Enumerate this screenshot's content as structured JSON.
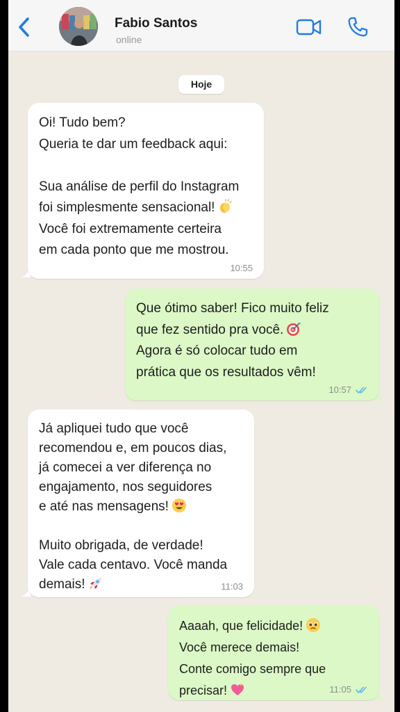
{
  "header": {
    "contact_name": "Fabio Santos",
    "status": "online"
  },
  "chat": {
    "date_label": "Hoje",
    "messages": [
      {
        "direction": "incoming",
        "lines": [
          "Oi! Tudo bem?",
          "Queria te dar um feedback aqui:",
          "",
          "Sua análise de perfil do Instagram",
          "foi simplesmente sensacional!",
          "Você foi extremamente certeira",
          "em cada ponto que me mostrou."
        ],
        "emoji": "clapping-hands",
        "time": "10:55"
      },
      {
        "direction": "outgoing",
        "lines": [
          "Que ótimo saber!  Fico muito feliz",
          "que fez sentido pra você.",
          "Agora é só colocar tudo em",
          "prática que os resultados vêm!"
        ],
        "emoji": "direct-hit-target",
        "time": "10:57",
        "read": true
      },
      {
        "direction": "incoming",
        "lines": [
          "Já apliquei tudo que você",
          "recomendou e, em poucos dias,",
          "já comecei a ver diferença no",
          "engajamento, nos seguidores",
          "e até nas mensagens!",
          "",
          "Muito obrigada, de verdade!",
          "Vale cada centavo. Você manda",
          "demais!"
        ],
        "emoji": [
          "smiling-face-with-heart-eyes",
          "rocket"
        ],
        "time": "11:03"
      },
      {
        "direction": "outgoing",
        "lines": [
          "Aaaah, que felicidade!",
          "Você merece demais!",
          "Conte comigo sempre que",
          "precisar!"
        ],
        "emoji": [
          "pleading-face",
          "sparkling-heart"
        ],
        "time": "11:05",
        "read": true
      }
    ]
  },
  "colors": {
    "accent": "#1f7be8",
    "background": "#efeae2",
    "incoming_bubble": "#ffffff",
    "outgoing_bubble": "#dbf8c6",
    "read_ticks": "#53bdeb"
  }
}
